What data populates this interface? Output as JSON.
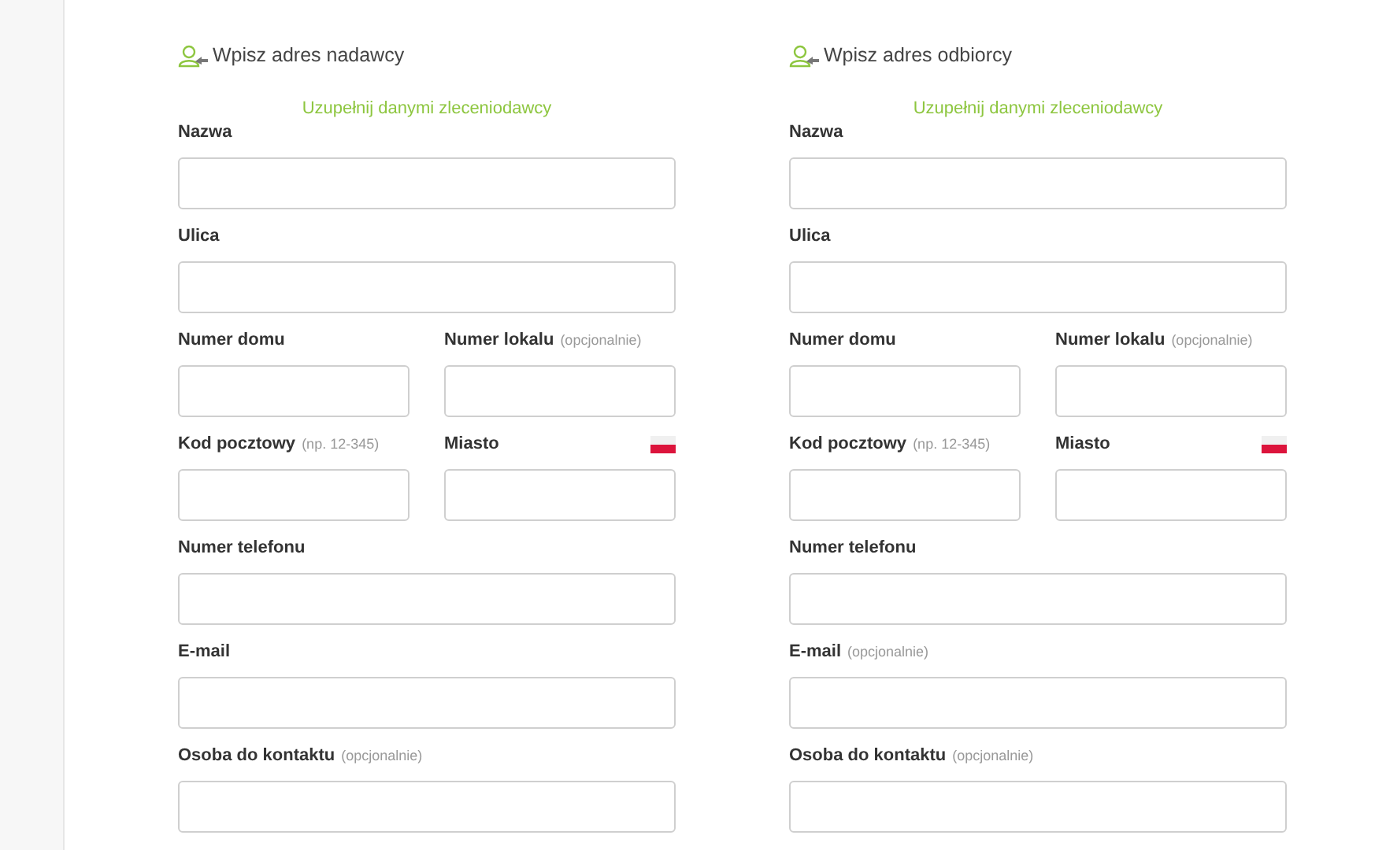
{
  "panels": [
    {
      "title": "Wpisz adres nadawcy",
      "fill_link": "Uzupełnij danymi zleceniodawcy",
      "rows": [
        {
          "kind": "full",
          "fields": [
            {
              "label": "Nazwa"
            }
          ]
        },
        {
          "kind": "full",
          "fields": [
            {
              "label": "Ulica"
            }
          ]
        },
        {
          "kind": "pair",
          "fields": [
            {
              "label": "Numer domu"
            },
            {
              "label": "Numer lokalu",
              "hint": "(opcjonalnie)"
            }
          ]
        },
        {
          "kind": "pair",
          "fields": [
            {
              "label": "Kod pocztowy",
              "hint": "(np. 12-345)"
            },
            {
              "label": "Miasto",
              "flag": true
            }
          ]
        },
        {
          "kind": "full",
          "fields": [
            {
              "label": "Numer telefonu"
            }
          ]
        },
        {
          "kind": "full",
          "fields": [
            {
              "label": "E-mail"
            }
          ]
        },
        {
          "kind": "full",
          "fields": [
            {
              "label": "Osoba do kontaktu",
              "hint": "(opcjonalnie)"
            }
          ]
        }
      ]
    },
    {
      "title": "Wpisz adres odbiorcy",
      "fill_link": "Uzupełnij danymi zleceniodawcy",
      "rows": [
        {
          "kind": "full",
          "fields": [
            {
              "label": "Nazwa"
            }
          ]
        },
        {
          "kind": "full",
          "fields": [
            {
              "label": "Ulica"
            }
          ]
        },
        {
          "kind": "pair",
          "fields": [
            {
              "label": "Numer domu"
            },
            {
              "label": "Numer lokalu",
              "hint": "(opcjonalnie)"
            }
          ]
        },
        {
          "kind": "pair",
          "fields": [
            {
              "label": "Kod pocztowy",
              "hint": "(np. 12-345)"
            },
            {
              "label": "Miasto",
              "flag": true
            }
          ]
        },
        {
          "kind": "full",
          "fields": [
            {
              "label": "Numer telefonu"
            }
          ]
        },
        {
          "kind": "full",
          "fields": [
            {
              "label": "E-mail",
              "hint": "(opcjonalnie)"
            }
          ]
        },
        {
          "kind": "full",
          "fields": [
            {
              "label": "Osoba do kontaktu",
              "hint": "(opcjonalnie)"
            }
          ]
        }
      ]
    }
  ]
}
